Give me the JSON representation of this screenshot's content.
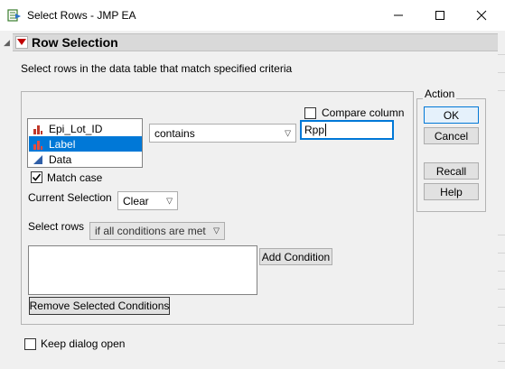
{
  "window": {
    "title": "Select Rows - JMP EA",
    "minimize_icon": "minimize-icon",
    "maximize_icon": "maximize-icon",
    "close_icon": "close-icon"
  },
  "section": {
    "title": "Row Selection",
    "description": "Select rows in the data table that match specified criteria"
  },
  "columns": {
    "items": [
      {
        "label": "Epi_Lot_ID",
        "icon": "nominal-bar-icon",
        "selected": false
      },
      {
        "label": "Label",
        "icon": "nominal-bar-icon",
        "selected": true
      },
      {
        "label": "Data",
        "icon": "continuous-triangle-icon",
        "selected": false
      }
    ]
  },
  "criteria": {
    "operator": "contains",
    "value": "Rpp",
    "compare_column_label": "Compare column",
    "compare_column_checked": false,
    "match_case_label": "Match case",
    "match_case_checked": true,
    "current_selection_label": "Current Selection",
    "current_selection_value": "Clear",
    "select_rows_label": "Select rows",
    "select_rows_value": "if all conditions are met",
    "add_condition_label": "Add Condition",
    "remove_conditions_label": "Remove Selected Conditions"
  },
  "action": {
    "legend": "Action",
    "ok": "OK",
    "cancel": "Cancel",
    "recall": "Recall",
    "help": "Help"
  },
  "footer": {
    "keep_open_label": "Keep dialog open",
    "keep_open_checked": false
  },
  "colors": {
    "accent": "#0078d7",
    "red_triangle": "#c00000",
    "nominal_icon": "#c0392b",
    "continuous_icon": "#2f5fa8"
  }
}
